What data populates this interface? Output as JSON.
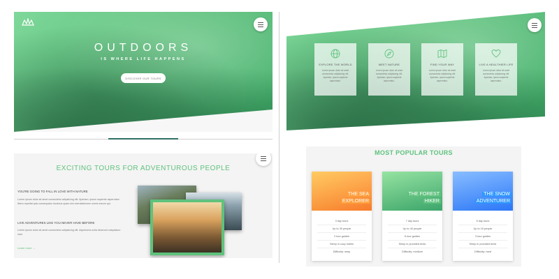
{
  "hero": {
    "title": "OUTDOORS",
    "subtitle": "IS WHERE LIFE HAPPENS",
    "button_label": "DISCOVER OUR TOURS"
  },
  "features": [
    {
      "icon": "globe-icon",
      "title": "EXPLORE THE WORLD",
      "text": "Lorem ipsum dolor sit amet consectetur adipisicing elit. Aperiam, ipsum sapiente aspernatur."
    },
    {
      "icon": "compass-icon",
      "title": "MEET NATURE",
      "text": "Lorem ipsum dolor sit amet consectetur adipisicing elit. Aperiam, ipsum sapiente aspernatur."
    },
    {
      "icon": "map-icon",
      "title": "FIND YOUR WAY",
      "text": "Lorem ipsum dolor sit amet consectetur adipisicing elit. Aperiam, ipsum sapiente aspernatur."
    },
    {
      "icon": "heart-icon",
      "title": "LIVE A HEALTHIER LIFE",
      "text": "Lorem ipsum dolor sit amet consectetur adipisicing elit. Aperiam, ipsum sapiente aspernatur."
    }
  ],
  "about": {
    "heading": "EXCITING TOURS FOR ADVENTUROUS PEOPLE",
    "h1": "YOU'RE GOING TO FALL IN LOVE WITH NATURE",
    "p1": "Lorem ipsum dolor sit amet consectetur adipisicing elit. Aperiam, ipsum sapiente aspernatur libero repellat quis consequatur ducimus quam nisi exercitationem omnis earum qui.",
    "h2": "LIVE ADVENTURES LIKE YOU NEVER HAVE BEFORE",
    "p2": "Lorem ipsum dolor sit amet consectetur adipisicing elit. Asperiores nulla deserunt voluptatum nam.",
    "link": "Learn more →"
  },
  "tours": {
    "heading": "MOST POPULAR TOURS",
    "items": [
      {
        "name_line1": "THE SEA",
        "name_line2": "EXPLORER",
        "color": "#ffb347",
        "details": [
          "3 day tours",
          "Up to 30 people",
          "2 tour guides",
          "Sleep in cozy hotels",
          "Difficulty: easy"
        ]
      },
      {
        "name_line1": "THE FOREST",
        "name_line2": "HIKER",
        "color": "#7ed56f",
        "details": [
          "7 day tours",
          "Up to 40 people",
          "6 tour guides",
          "Sleep in provided tents",
          "Difficulty: medium"
        ]
      },
      {
        "name_line1": "THE SNOW",
        "name_line2": "ADVENTURER",
        "color": "#2998ff",
        "details": [
          "5 day tours",
          "Up to 15 people",
          "3 tour guides",
          "Sleep in provided tents",
          "Difficulty: hard"
        ]
      }
    ]
  },
  "colors": {
    "accent": "#5fc27d",
    "accent_dark": "#2f6f64"
  }
}
